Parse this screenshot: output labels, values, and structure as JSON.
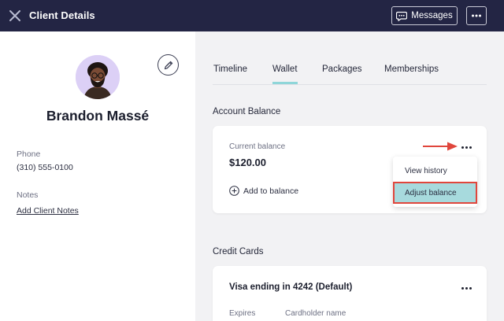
{
  "header": {
    "title": "Client Details",
    "messages_label": "Messages"
  },
  "client": {
    "name": "Brandon Massé",
    "phone_label": "Phone",
    "phone": "(310) 555-0100",
    "notes_label": "Notes",
    "notes_link": "Add Client Notes"
  },
  "tabs": [
    {
      "label": "Timeline",
      "active": false
    },
    {
      "label": "Wallet",
      "active": true
    },
    {
      "label": "Packages",
      "active": false
    },
    {
      "label": "Memberships",
      "active": false
    }
  ],
  "account_balance": {
    "section_title": "Account Balance",
    "current_balance_label": "Current balance",
    "amount": "$120.00",
    "add_label": "Add to balance"
  },
  "menu": {
    "items": [
      "View history",
      "Adjust balance"
    ],
    "highlighted_index": 1
  },
  "credit_cards": {
    "section_title": "Credit Cards",
    "card_title": "Visa ending in 4242 (Default)",
    "columns": [
      "Expires",
      "Cardholder name"
    ]
  },
  "colors": {
    "header_bg": "#232544",
    "tab_accent": "#8fd6d9",
    "menu_highlight": "#a7dadd",
    "annotation_red": "#e0463c",
    "avatar_bg": "#dcd0f6"
  }
}
